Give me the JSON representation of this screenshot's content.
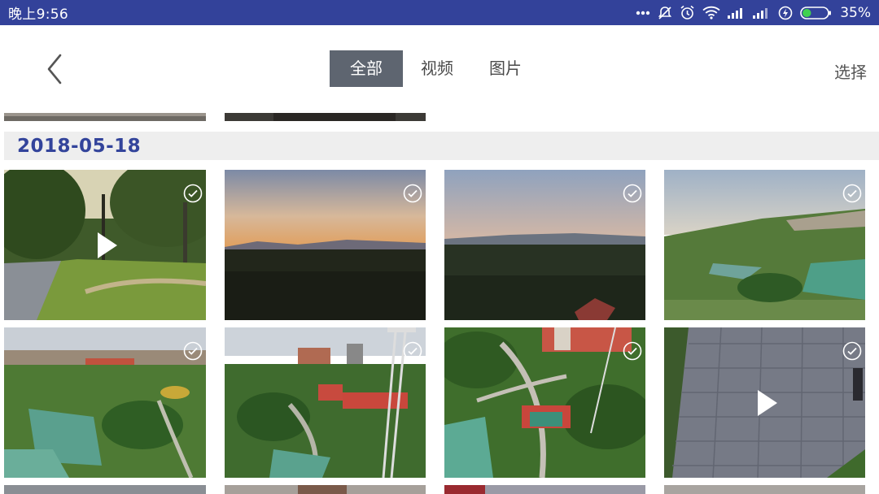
{
  "status_bar": {
    "time": "晚上9:56",
    "battery_percent": "35%",
    "battery_level": 0.35,
    "background": "#33429a",
    "icons": [
      "dots-icon",
      "mute-icon",
      "alarm-icon",
      "wifi-icon",
      "signal-icon",
      "signal-icon",
      "charging-icon",
      "battery-icon"
    ]
  },
  "header": {
    "back_icon": "back-arrow-icon",
    "tabs": [
      {
        "label": "全部",
        "active": true
      },
      {
        "label": "视频",
        "active": false
      },
      {
        "label": "图片",
        "active": false
      }
    ],
    "select_label": "选择",
    "active_tab_color": "#5e6570"
  },
  "gallery": {
    "date": "2018-05-18",
    "date_color": "#33449b",
    "items": [
      {
        "type": "video",
        "scene": "park path with trees"
      },
      {
        "type": "image",
        "scene": "sunset over hills"
      },
      {
        "type": "image",
        "scene": "dusk sky over forest"
      },
      {
        "type": "image",
        "scene": "aerial view of park and town"
      },
      {
        "type": "image",
        "scene": "aerial view of town and green land"
      },
      {
        "type": "image",
        "scene": "aerial view with transmission tower"
      },
      {
        "type": "image",
        "scene": "aerial view of park paths"
      },
      {
        "type": "video",
        "scene": "paved plaza tiles"
      }
    ]
  }
}
